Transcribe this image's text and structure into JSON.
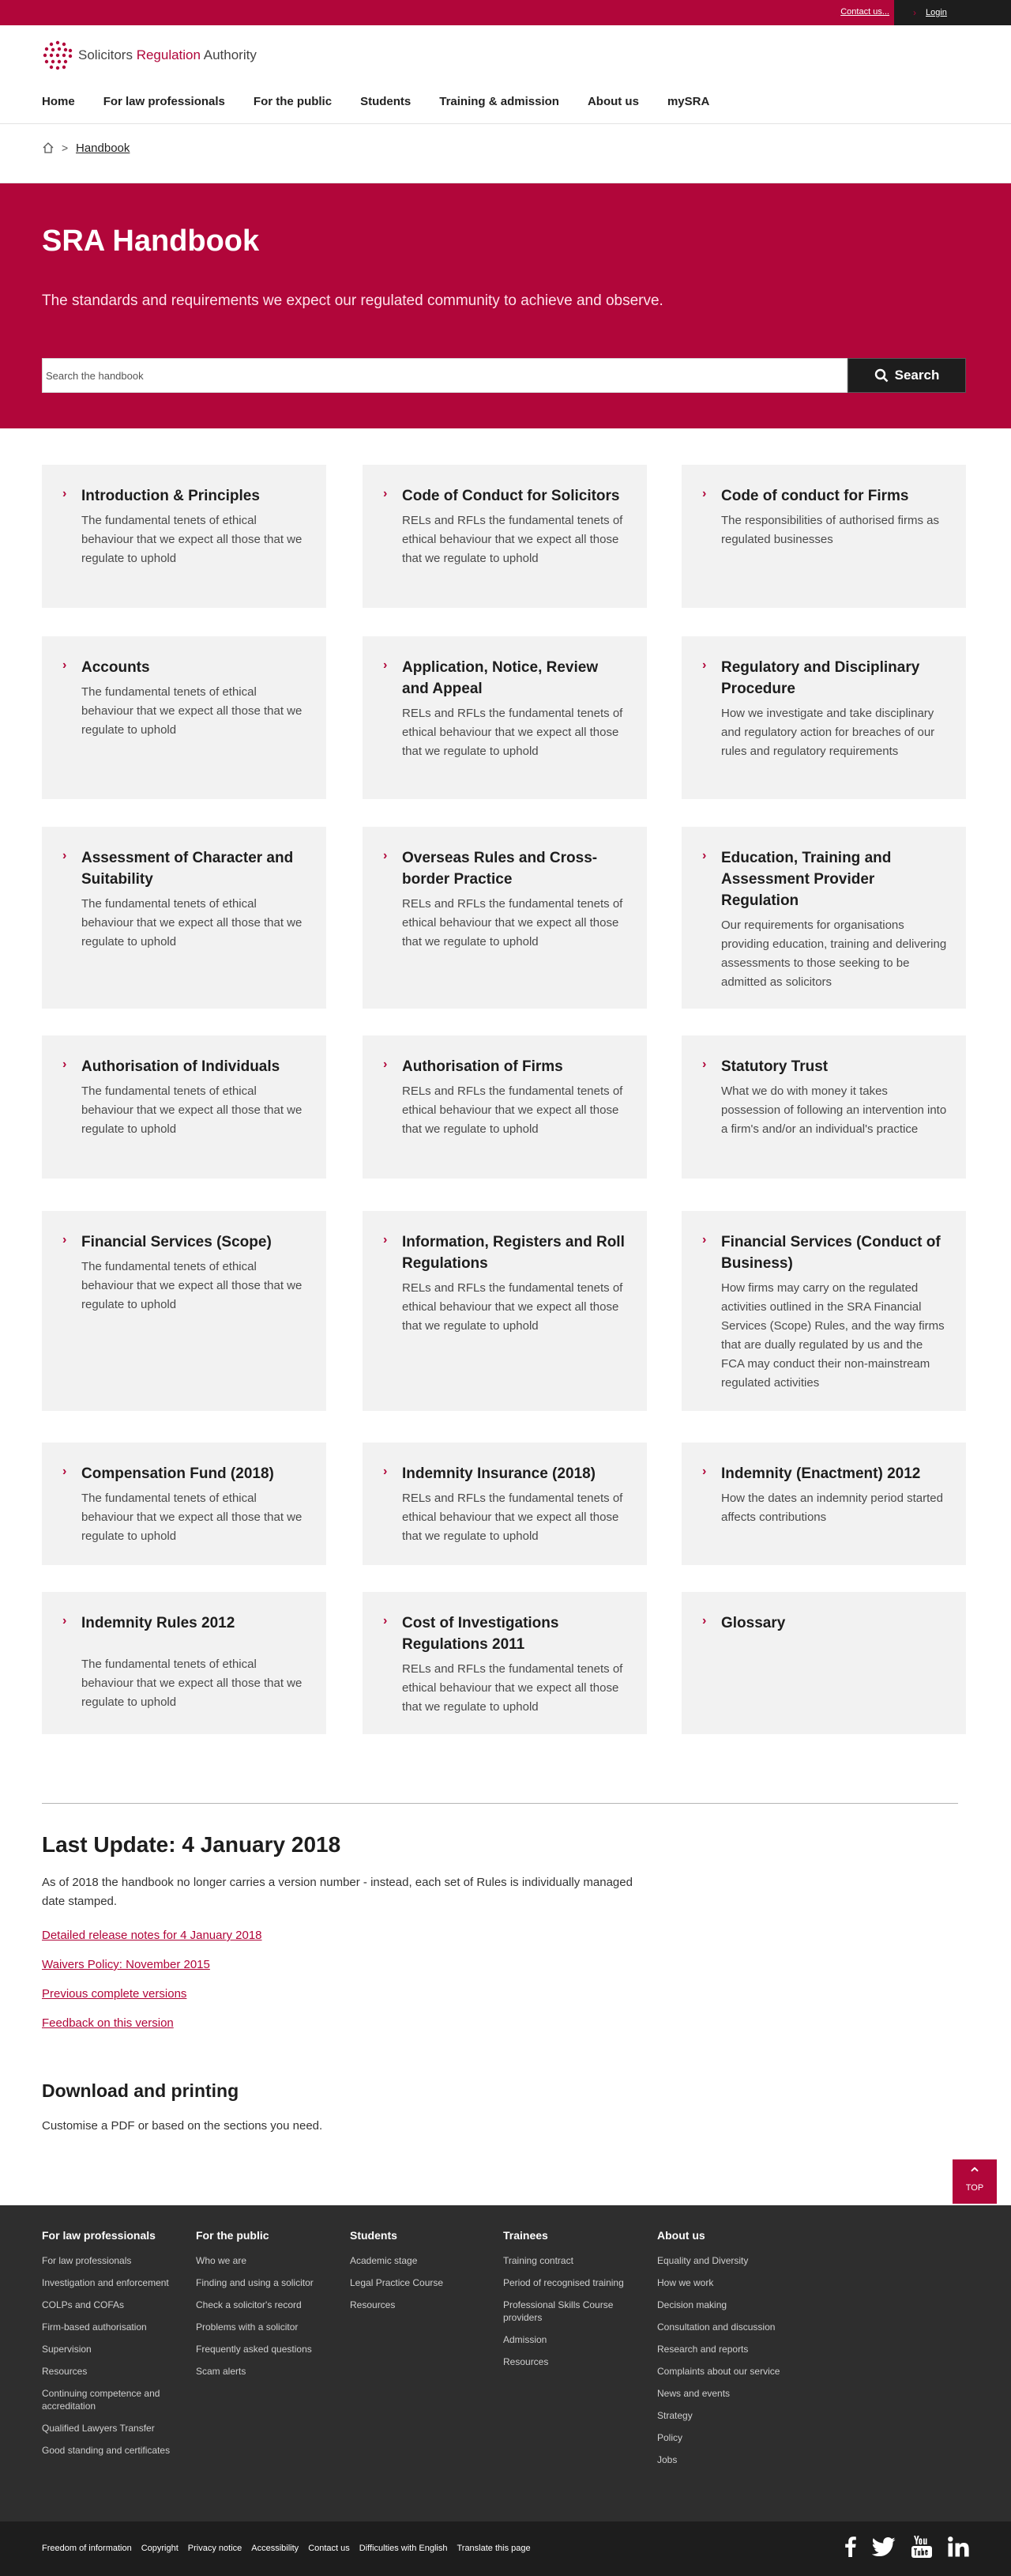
{
  "utility": {
    "contact": "Contact us...",
    "login": "Login"
  },
  "logo": {
    "part1": "Solicitors ",
    "part2": "Regulation",
    "part3": " Authority"
  },
  "nav": [
    "Home",
    "For law professionals",
    "For the public",
    "Students",
    "Training & admission",
    "About us",
    "mySRA"
  ],
  "breadcrumb": {
    "current": "Handbook"
  },
  "hero": {
    "title": "SRA Handbook",
    "subtitle": "The standards and requirements we expect our regulated community to achieve and observe.",
    "search_placeholder": "Search the handbook",
    "search_button": "Search"
  },
  "cards": [
    {
      "title": "Introduction & Principles",
      "desc": "The fundamental tenets of ethical behaviour that we expect all those that we regulate to uphold"
    },
    {
      "title": "Code of Conduct for Solicitors",
      "desc": "RELs and RFLs the fundamental tenets of ethical behaviour that we expect all those that we regulate to uphold"
    },
    {
      "title": "Code of conduct for Firms",
      "desc": "The responsibilities of authorised firms as regulated businesses"
    },
    {
      "title": "Accounts",
      "desc": "The fundamental tenets of ethical behaviour that we expect all those that we regulate to uphold"
    },
    {
      "title": "Application, Notice, Review and Appeal",
      "desc": "RELs and RFLs the fundamental tenets of ethical behaviour that we expect all those that we regulate to uphold"
    },
    {
      "title": "Regulatory and Disciplinary Procedure",
      "desc": "How we investigate and take disciplinary and regulatory action for breaches of our rules and regulatory requirements"
    },
    {
      "title": "Assessment of Character and Suitability",
      "desc": "The fundamental tenets of ethical behaviour that we expect all those that we regulate to uphold"
    },
    {
      "title": "Overseas Rules and Cross-border Practice",
      "desc": "RELs and RFLs the fundamental tenets of ethical behaviour that we expect all those that we regulate to uphold"
    },
    {
      "title": "Education, Training and Assessment Provider Regulation",
      "desc": "Our requirements for organisations providing education, training and delivering assessments to those seeking to be admitted as solicitors"
    },
    {
      "title": "Authorisation of Individuals",
      "desc": "The fundamental tenets of ethical behaviour that we expect all those that we regulate to uphold"
    },
    {
      "title": "Authorisation of Firms",
      "desc": "RELs and RFLs the fundamental tenets of ethical behaviour that we expect all those that we regulate to uphold"
    },
    {
      "title": "Statutory Trust",
      "desc": "What we do with money it takes possession of following an intervention into a firm's and/or an individual's practice"
    },
    {
      "title": "Financial Services (Scope)",
      "desc": "The fundamental tenets of ethical behaviour that we expect all those that we regulate to uphold"
    },
    {
      "title": "Information, Registers and Roll Regulations",
      "desc": "RELs and RFLs the fundamental tenets of ethical behaviour that we expect all those that we regulate to uphold"
    },
    {
      "title": "Financial Services (Conduct of Business)",
      "desc": "How firms may carry on the regulated activities outlined in the SRA Financial Services (Scope) Rules, and the way firms that are dually regulated by us and the FCA may conduct their non-mainstream regulated activities"
    },
    {
      "title": "Compensation Fund (2018)",
      "desc": "The fundamental tenets of ethical behaviour that we expect all those that we regulate to uphold"
    },
    {
      "title": "Indemnity Insurance (2018)",
      "desc": "RELs and RFLs the fundamental tenets of ethical behaviour that we expect all those that we regulate to uphold"
    },
    {
      "title": "Indemnity (Enactment) 2012",
      "desc": "How the dates an indemnity period started affects contributions"
    },
    {
      "title": "Indemnity Rules 2012",
      "desc": "The fundamental tenets of ethical behaviour that we expect all those that we regulate to uphold"
    },
    {
      "title": "Cost of Investigations Regulations 2011",
      "desc": "RELs and RFLs the fundamental tenets of ethical behaviour that we expect all those that we regulate to uphold"
    },
    {
      "title": "Glossary",
      "desc": ""
    }
  ],
  "last_update": {
    "title": "Last Update: 4 January 2018",
    "text": "As of 2018 the handbook no longer carries a version number - instead, each set of Rules is individually managed date stamped.",
    "links": [
      "Detailed release notes for 4 January 2018",
      "Waivers Policy: November 2015",
      "Previous complete versions",
      "Feedback on this version"
    ]
  },
  "download": {
    "title": "Download and printing",
    "text": "Customise a PDF or based on the sections you need."
  },
  "top_button": "TOP",
  "footer": {
    "columns": [
      {
        "heading": "For law professionals",
        "items": [
          "For law professionals",
          "Investigation and enforcement",
          "COLPs and COFAs",
          "Firm-based authorisation",
          "Supervision",
          "Resources",
          "Continuing competence and accreditation",
          "Qualified Lawyers Transfer",
          "Good standing and certificates"
        ]
      },
      {
        "heading": "For the public",
        "items": [
          "Who we are",
          "Finding and using a solicitor",
          "Check a solicitor's record",
          "Problems with a solicitor",
          "Frequently asked questions",
          "Scam alerts"
        ]
      },
      {
        "heading": "Students",
        "items": [
          "Academic stage",
          "Legal Practice Course",
          "Resources"
        ]
      },
      {
        "heading": "Trainees",
        "items": [
          "Training contract",
          "Period of recognised training",
          "Professional Skills Course providers",
          "Admission",
          "Resources"
        ]
      },
      {
        "heading": "About us",
        "items": [
          "Equality and Diversity",
          "How we work",
          "Decision making",
          "Consultation and discussion",
          "Research and reports",
          "Complaints about our service",
          "News and events",
          "Strategy",
          "Policy",
          "Jobs"
        ]
      }
    ],
    "bottom_links": [
      "Freedom of information",
      "Copyright",
      "Privacy notice",
      "Accessibility",
      "Contact us",
      "Difficulties with English",
      "Translate this page"
    ],
    "social": [
      "facebook-icon",
      "twitter-icon",
      "youtube-icon",
      "linkedin-icon"
    ]
  }
}
